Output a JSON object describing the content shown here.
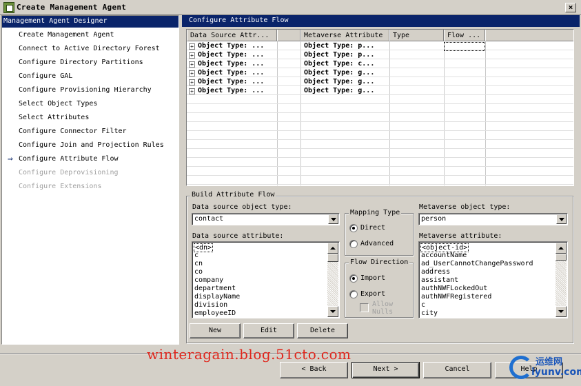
{
  "window": {
    "title": "Create Management Agent",
    "close_label": "×"
  },
  "left": {
    "header": "Management Agent Designer",
    "current_marker": "⇒",
    "items": [
      {
        "label": "Create Management Agent",
        "enabled": true
      },
      {
        "label": "Connect to Active Directory Forest",
        "enabled": true
      },
      {
        "label": "Configure Directory Partitions",
        "enabled": true
      },
      {
        "label": "Configure GAL",
        "enabled": true
      },
      {
        "label": "Configure Provisioning Hierarchy",
        "enabled": true
      },
      {
        "label": "Select Object Types",
        "enabled": true
      },
      {
        "label": "Select Attributes",
        "enabled": true
      },
      {
        "label": "Configure Connector Filter",
        "enabled": true
      },
      {
        "label": "Configure Join and Projection Rules",
        "enabled": true
      },
      {
        "label": "Configure Attribute Flow",
        "enabled": true,
        "current": true
      },
      {
        "label": "Configure Deprovisioning",
        "enabled": false
      },
      {
        "label": "Configure Extensions",
        "enabled": false
      }
    ]
  },
  "right": {
    "header": "Configure Attribute Flow",
    "grid": {
      "columns": [
        "Data Source Attr...",
        "",
        "Metaverse Attribute",
        "Type",
        "Flow ..."
      ],
      "rows": [
        {
          "expand": "+",
          "source": "Object Type: ...",
          "metaverse": "Object Type: p..."
        },
        {
          "expand": "+",
          "source": "Object Type: ...",
          "metaverse": "Object Type: p..."
        },
        {
          "expand": "+",
          "source": "Object Type: ...",
          "metaverse": "Object Type: c..."
        },
        {
          "expand": "+",
          "source": "Object Type: ...",
          "metaverse": "Object Type: g..."
        },
        {
          "expand": "+",
          "source": "Object Type: ...",
          "metaverse": "Object Type: g..."
        },
        {
          "expand": "+",
          "source": "Object Type: ...",
          "metaverse": "Object Type: g..."
        }
      ]
    },
    "build": {
      "title": "Build Attribute Flow",
      "ds_object_type_label": "Data source object type:",
      "ds_object_type_value": "contact",
      "ds_attribute_label": "Data source attribute:",
      "ds_attributes": [
        "<dn>",
        "c",
        "cn",
        "co",
        "company",
        "department",
        "displayName",
        "division",
        "employeeID"
      ],
      "mapping_type": {
        "title": "Mapping Type",
        "direct": "Direct",
        "advanced": "Advanced",
        "selected": "Direct"
      },
      "flow_direction": {
        "title": "Flow Direction",
        "import": "Import",
        "export": "Export",
        "selected": "Import",
        "allow_nulls": "Allow Nulls"
      },
      "mv_object_type_label": "Metaverse object type:",
      "mv_object_type_value": "person",
      "mv_attribute_label": "Metaverse attribute:",
      "mv_attributes": [
        "<object-id>",
        "accountName",
        "ad_UserCannotChangePassword",
        "address",
        "assistant",
        "authNWFLockedOut",
        "authNWFRegistered",
        "c",
        "city"
      ],
      "buttons": {
        "new": "New",
        "edit": "Edit",
        "delete": "Delete"
      }
    }
  },
  "footer": {
    "back": "< Back",
    "next": "Next >",
    "cancel": "Cancel",
    "help": "Help",
    "watermark": "winteragain.blog.51cto.com",
    "logo_cn": "运维网",
    "logo_en": "iyunv.com"
  }
}
